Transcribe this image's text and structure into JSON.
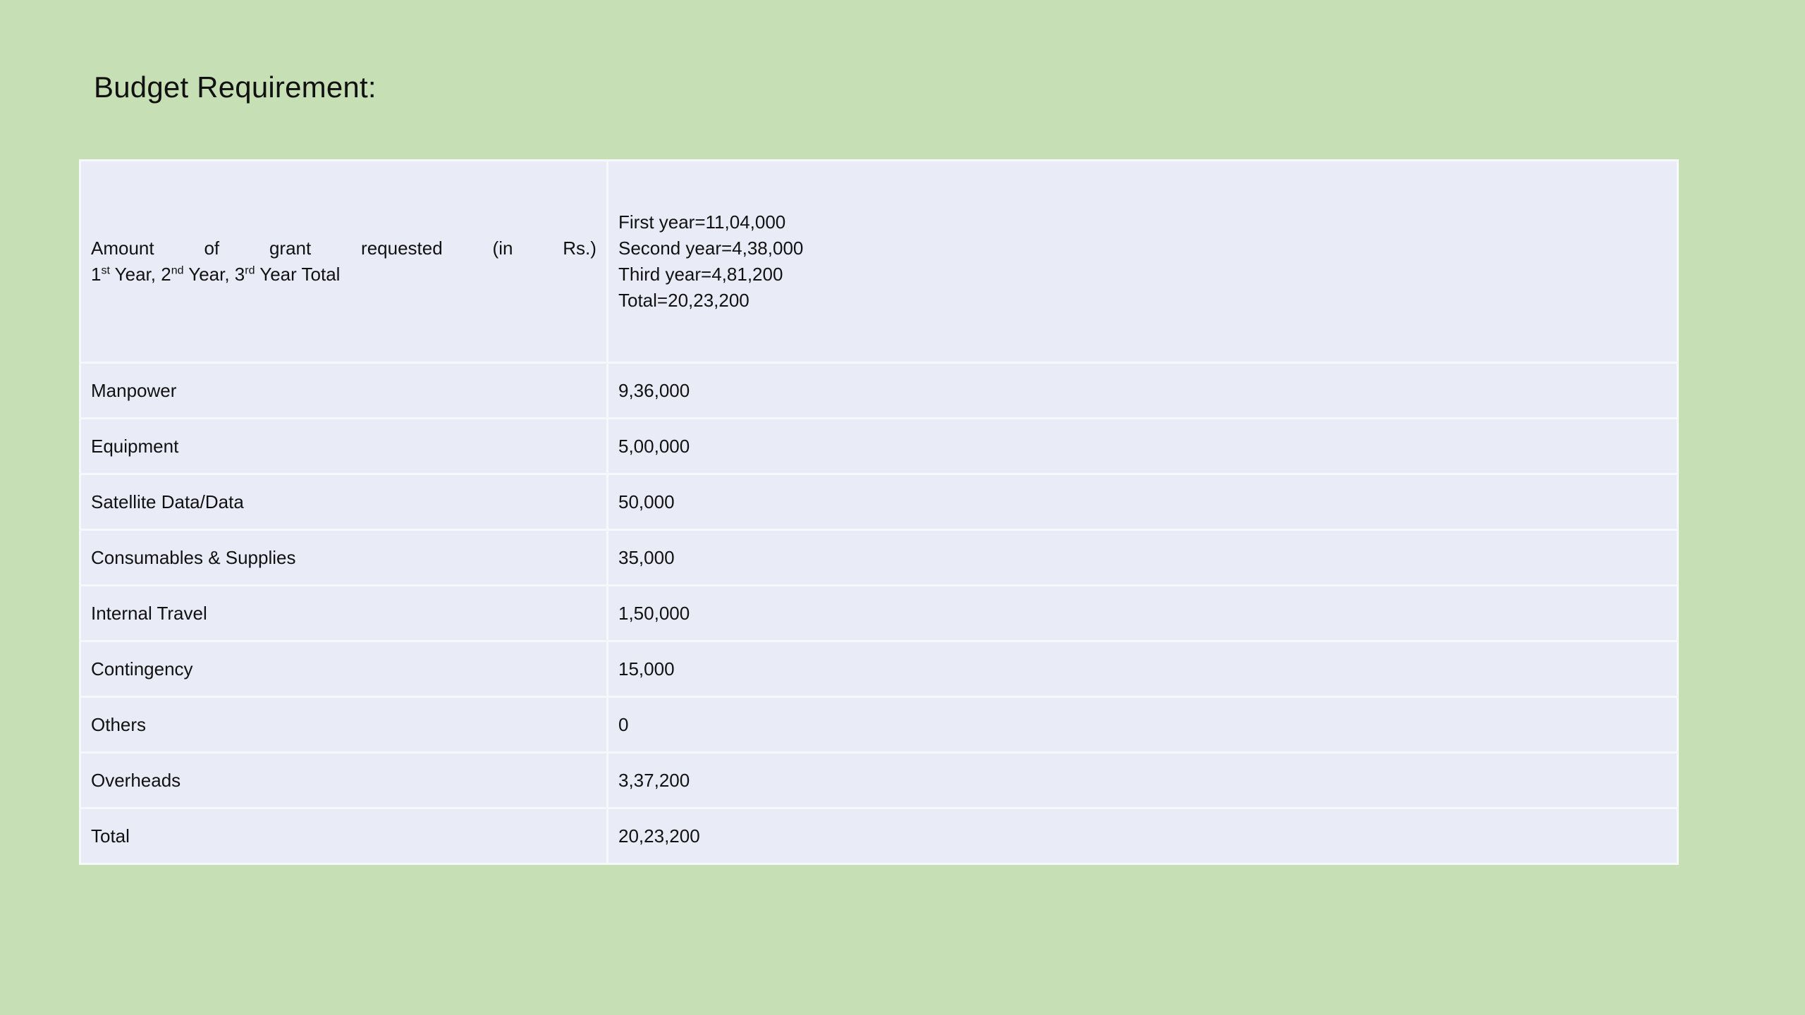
{
  "slide": {
    "title": "Budget Requirement:"
  },
  "table": {
    "header": {
      "label_words": [
        "Amount",
        "of",
        "grant",
        "requested",
        "(in",
        "Rs.)"
      ],
      "label_line2": {
        "y1_num": "1",
        "y1_sup": "st",
        "y1_text": " Year, 2",
        "y2_sup": "nd",
        "y2_text": " Year, 3",
        "y3_sup": "rd",
        "y3_text": " Year Total"
      },
      "amounts": [
        "First year=11,04,000",
        "Second year=4,38,000",
        "Third year=4,81,200",
        "Total=20,23,200"
      ]
    },
    "rows": [
      {
        "label": "Manpower",
        "value": "9,36,000"
      },
      {
        "label": "Equipment",
        "value": "5,00,000"
      },
      {
        "label": "Satellite Data/Data",
        "value": "50,000"
      },
      {
        "label": "Consumables & Supplies",
        "value": "35,000"
      },
      {
        "label": "Internal Travel",
        "value": "1,50,000"
      },
      {
        "label": "Contingency",
        "value": "15,000"
      },
      {
        "label": "Others",
        "value": "0"
      },
      {
        "label": "Overheads",
        "value": "3,37,200"
      },
      {
        "label": "Total",
        "value": "20,23,200"
      }
    ]
  }
}
